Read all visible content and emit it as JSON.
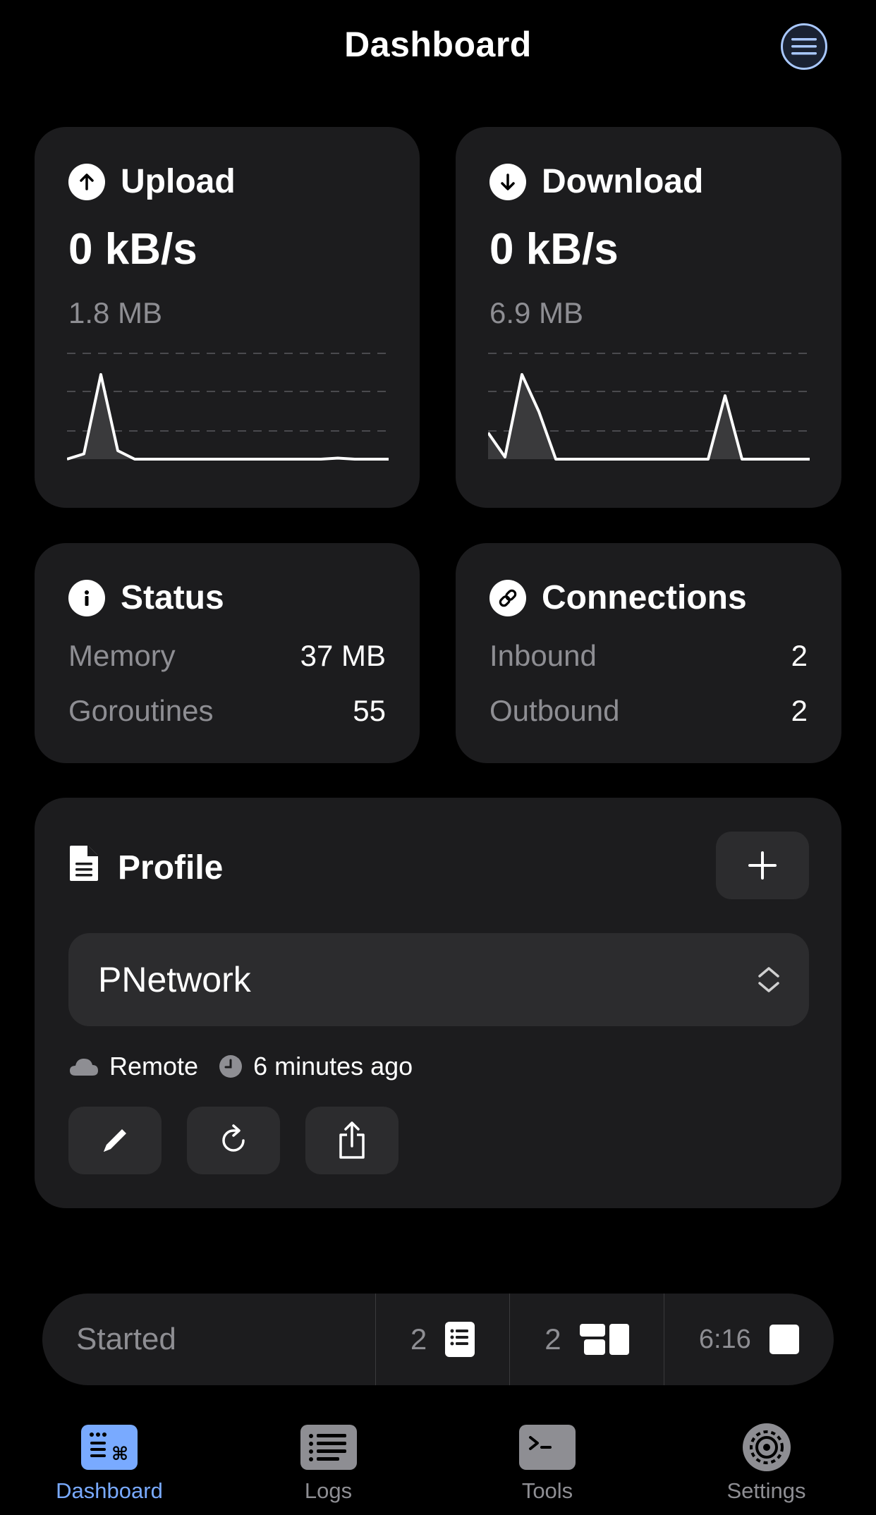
{
  "header": {
    "title": "Dashboard",
    "menu_icon": "list-circle-icon"
  },
  "upload": {
    "label": "Upload",
    "icon": "arrow-up-circle-icon",
    "rate": "0 kB/s",
    "total": "1.8 MB",
    "graph": [
      0,
      0.05,
      0.8,
      0.08,
      0,
      0,
      0,
      0,
      0,
      0,
      0,
      0,
      0,
      0,
      0,
      0,
      0.01,
      0,
      0,
      0
    ]
  },
  "download": {
    "label": "Download",
    "icon": "arrow-down-circle-icon",
    "rate": "0 kB/s",
    "total": "6.9 MB",
    "graph": [
      0.25,
      0.02,
      0.8,
      0.45,
      0,
      0,
      0,
      0,
      0,
      0,
      0,
      0,
      0,
      0,
      0.6,
      0,
      0,
      0,
      0,
      0
    ]
  },
  "status": {
    "label": "Status",
    "icon": "info-circle-icon",
    "memory_label": "Memory",
    "memory_value": "37 MB",
    "goroutines_label": "Goroutines",
    "goroutines_value": "55"
  },
  "connections": {
    "label": "Connections",
    "icon": "link-circle-icon",
    "inbound_label": "Inbound",
    "inbound_value": "2",
    "outbound_label": "Outbound",
    "outbound_value": "2"
  },
  "profile": {
    "label": "Profile",
    "icon": "document-icon",
    "selected": "PNetwork",
    "source": "Remote",
    "updated": "6 minutes ago"
  },
  "statusbar": {
    "state": "Started",
    "count_a": "2",
    "count_b": "2",
    "time": "6:16"
  },
  "tabs": [
    {
      "label": "Dashboard",
      "icon": "dashboard-icon",
      "active": true
    },
    {
      "label": "Logs",
      "icon": "logs-icon",
      "active": false
    },
    {
      "label": "Tools",
      "icon": "terminal-icon",
      "active": false
    },
    {
      "label": "Settings",
      "icon": "gear-icon",
      "active": false
    }
  ],
  "colors": {
    "accent": "#79aaff",
    "card": "#1c1c1e",
    "secondary_text": "#8e8e93"
  }
}
